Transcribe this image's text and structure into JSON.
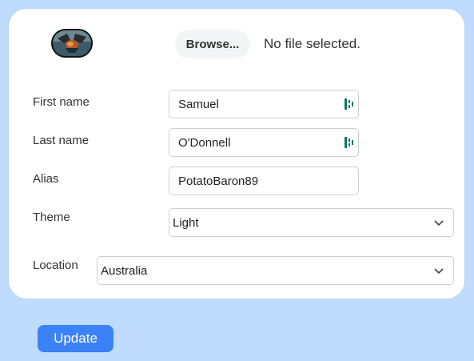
{
  "avatar": {
    "icon": "dragon-avatar-image"
  },
  "file_picker": {
    "button_label": "Browse...",
    "status": "No file selected."
  },
  "form": {
    "first_name": {
      "label": "First name",
      "value": "Samuel",
      "icon": "autofill-key-icon"
    },
    "last_name": {
      "label": "Last name",
      "value": "O'Donnell",
      "icon": "autofill-key-icon"
    },
    "alias": {
      "label": "Alias",
      "value": "PotatoBaron89"
    },
    "theme": {
      "label": "Theme",
      "value": "Light"
    },
    "location": {
      "label": "Location",
      "value": "Australia"
    }
  },
  "actions": {
    "update_label": "Update"
  },
  "colors": {
    "page_background": "#bfdbfe",
    "card_background": "#ffffff",
    "primary_button": "#3b82f6",
    "autofill_icon": "#0f766e"
  }
}
